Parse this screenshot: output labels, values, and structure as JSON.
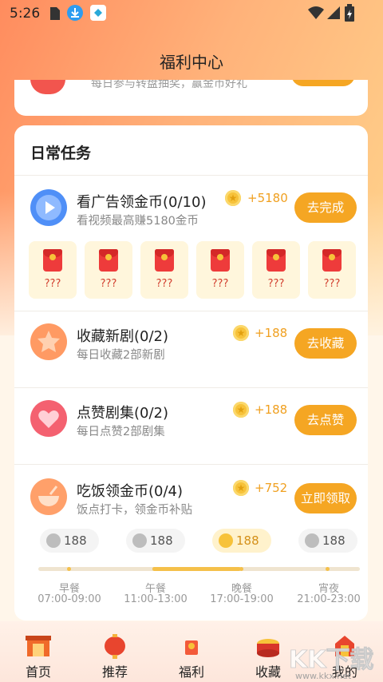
{
  "status_bar": {
    "time": "5:26"
  },
  "header": {
    "title": "福利中心"
  },
  "prev_card": {
    "text": "每日参与转盘抽奖，赢金币好礼"
  },
  "daily": {
    "title": "日常任务",
    "tasks": [
      {
        "title": "看广告领金币(0/10)",
        "subtitle": "看视频最高赚5180金币",
        "reward": "+5180",
        "button": "去完成",
        "icon": "play-icon",
        "color": "#4f8ff7"
      },
      {
        "title": "收藏新剧(0/2)",
        "subtitle": "每日收藏2部新剧",
        "reward": "+188",
        "button": "去收藏",
        "icon": "star-icon",
        "color": "#ff9a63"
      },
      {
        "title": "点赞剧集(0/2)",
        "subtitle": "每日点赞2部剧集",
        "reward": "+188",
        "button": "去点赞",
        "icon": "heart-icon",
        "color": "#f46170"
      },
      {
        "title": "吃饭领金币(0/4)",
        "subtitle": "饭点打卡，领金币补贴",
        "reward": "+752",
        "button": "立即领取",
        "icon": "bowl-icon",
        "color": "#ffa06a"
      }
    ],
    "envelopes": [
      "???",
      "???",
      "???",
      "???",
      "???",
      "???"
    ],
    "meals": [
      {
        "name": "早餐",
        "time": "07:00-09:00",
        "coins": "188",
        "active": false
      },
      {
        "name": "午餐",
        "time": "11:00-13:00",
        "coins": "188",
        "active": false
      },
      {
        "name": "晚餐",
        "time": "17:00-19:00",
        "coins": "188",
        "active": true
      },
      {
        "name": "宵夜",
        "time": "21:00-23:00",
        "coins": "188",
        "active": false
      }
    ]
  },
  "tabbar": [
    {
      "label": "首页",
      "icon": "home-icon"
    },
    {
      "label": "推荐",
      "icon": "lantern-icon"
    },
    {
      "label": "福利",
      "icon": "gift-icon"
    },
    {
      "label": "收藏",
      "icon": "drum-icon"
    },
    {
      "label": "我的",
      "icon": "profile-icon"
    }
  ],
  "watermark": {
    "text": "KK下载",
    "url": "www.kkx.net"
  },
  "colors": {
    "accent": "#f5a623",
    "reward": "#f0a020"
  }
}
